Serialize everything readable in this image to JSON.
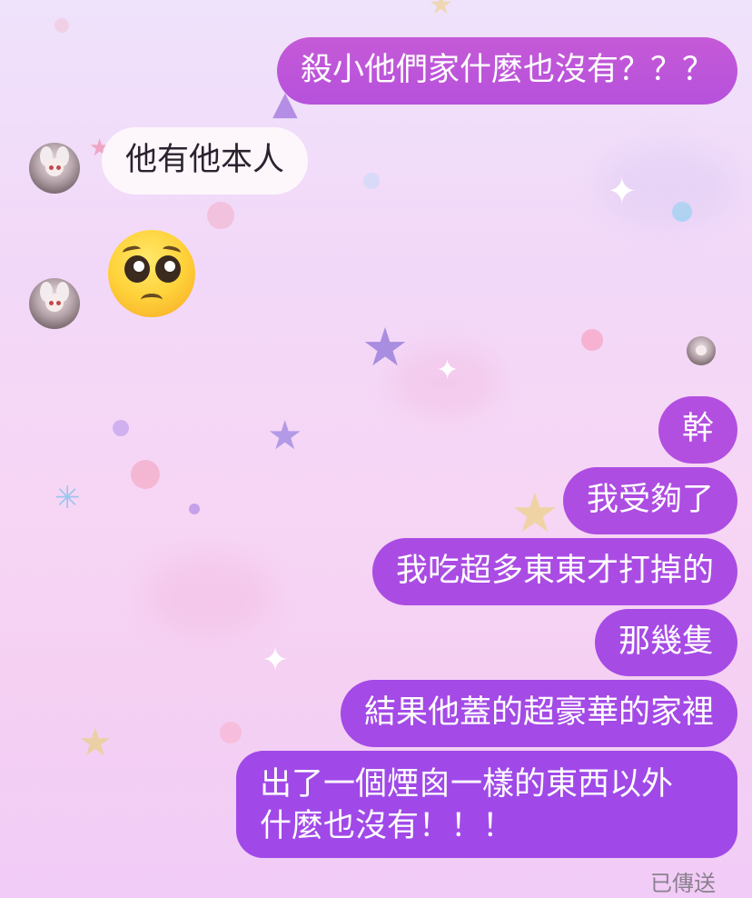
{
  "messages": [
    {
      "id": "m1",
      "direction": "outgoing",
      "text": "殺小他們家什麼也沒有？？？"
    },
    {
      "id": "m2",
      "direction": "incoming",
      "text": "他有他本人"
    },
    {
      "id": "m3",
      "direction": "incoming",
      "type": "emoji",
      "emoji": "pleading-face"
    },
    {
      "id": "m4",
      "direction": "outgoing",
      "text": "幹"
    },
    {
      "id": "m5",
      "direction": "outgoing",
      "text": "我受夠了"
    },
    {
      "id": "m6",
      "direction": "outgoing",
      "text": "我吃超多東東才打掉的"
    },
    {
      "id": "m7",
      "direction": "outgoing",
      "text": "那幾隻"
    },
    {
      "id": "m8",
      "direction": "outgoing",
      "text": "結果他蓋的超豪華的家裡"
    },
    {
      "id": "m9",
      "direction": "outgoing",
      "lines": [
        "出了一個煙囪一樣的東西以外",
        "什麼也沒有！！！"
      ]
    }
  ],
  "status": {
    "sent_label": "已傳送"
  },
  "colors": {
    "outgoing_bubble_top": "#c35ad8",
    "outgoing_bubble_bottom": "#a04ee8",
    "incoming_bubble": "#fdf7fc",
    "status_text": "#8b8090"
  }
}
